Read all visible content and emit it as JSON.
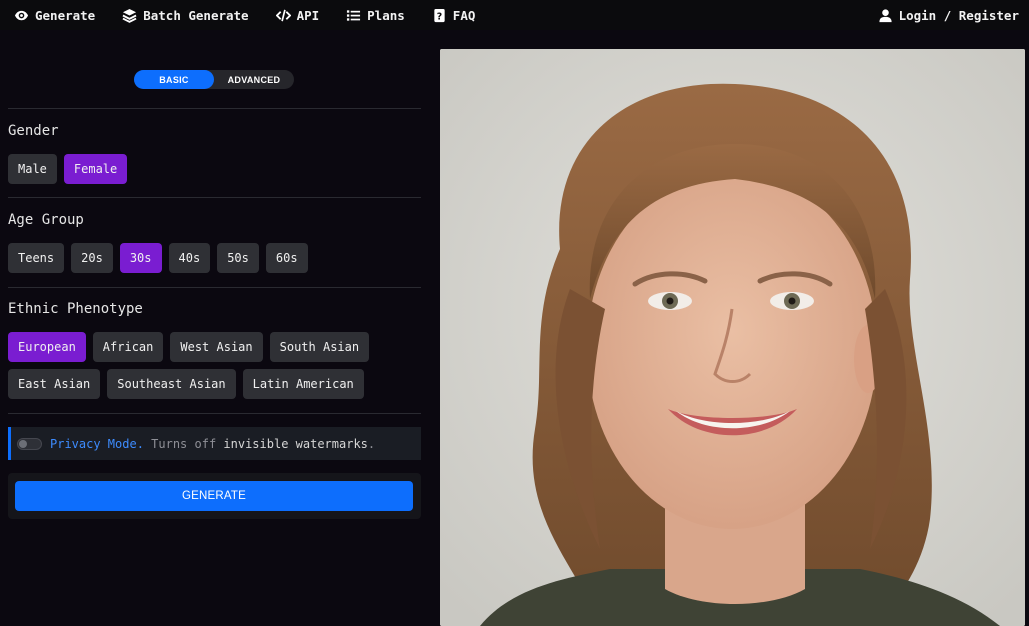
{
  "nav": {
    "links": [
      {
        "label": "Generate",
        "icon": "eye-icon"
      },
      {
        "label": "Batch Generate",
        "icon": "layers-icon"
      },
      {
        "label": "API",
        "icon": "code-icon"
      },
      {
        "label": "Plans",
        "icon": "list-icon"
      },
      {
        "label": "FAQ",
        "icon": "question-icon"
      }
    ],
    "login": {
      "label": "Login / Register",
      "icon": "user-icon"
    }
  },
  "mode_toggle": {
    "basic": "BASIC",
    "advanced": "ADVANCED",
    "selected": "BASIC"
  },
  "gender": {
    "label": "Gender",
    "options": [
      "Male",
      "Female"
    ],
    "selected": "Female"
  },
  "age_group": {
    "label": "Age Group",
    "options": [
      "Teens",
      "20s",
      "30s",
      "40s",
      "50s",
      "60s"
    ],
    "selected": "30s"
  },
  "ethnic_phenotype": {
    "label": "Ethnic Phenotype",
    "options_row1": [
      "European",
      "African",
      "West Asian",
      "South Asian"
    ],
    "options_row2": [
      "East Asian",
      "Southeast Asian",
      "Latin American"
    ],
    "selected": "European"
  },
  "privacy": {
    "title": "Privacy Mode.",
    "desc": " Turns off ",
    "strong": "invisible watermarks",
    "end": ".",
    "enabled": false
  },
  "generate_label": "GENERATE",
  "colors": {
    "accent_blue": "#0d6efd",
    "selected_purple": "#7a1dd1",
    "background": "#0b0810"
  }
}
